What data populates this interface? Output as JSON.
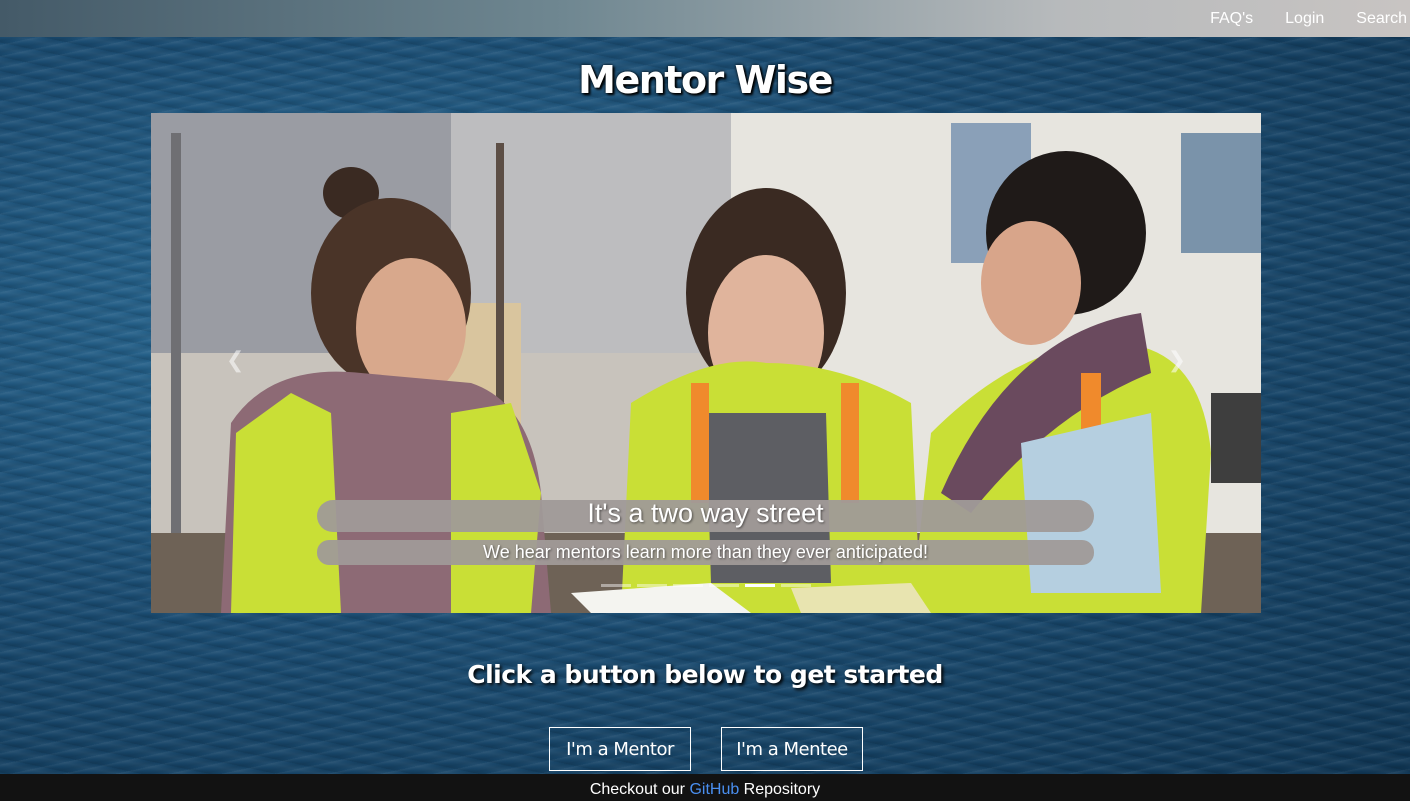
{
  "nav": {
    "faqs": "FAQ's",
    "login": "Login",
    "search": "Search"
  },
  "site_title": "Mentor Wise",
  "carousel": {
    "caption_title": "It's a two way street",
    "caption_subtitle": "We hear mentors learn more than they ever anticipated!",
    "prev_label": "Previous",
    "next_label": "Next",
    "slide_count": 6,
    "active_slide": 5,
    "image": "three women in high-visibility vests reviewing papers outdoors"
  },
  "cta": {
    "heading": "Click a button below to get started",
    "mentor_button": "I'm a Mentor",
    "mentee_button": "I'm a Mentee"
  },
  "footer": {
    "prefix": "Checkout our ",
    "link_text": "GitHub",
    "suffix": " Repository",
    "link_color": "#4a8ff0"
  },
  "colors": {
    "footer_bg": "#121212",
    "caption_bg": "#a09a98"
  }
}
